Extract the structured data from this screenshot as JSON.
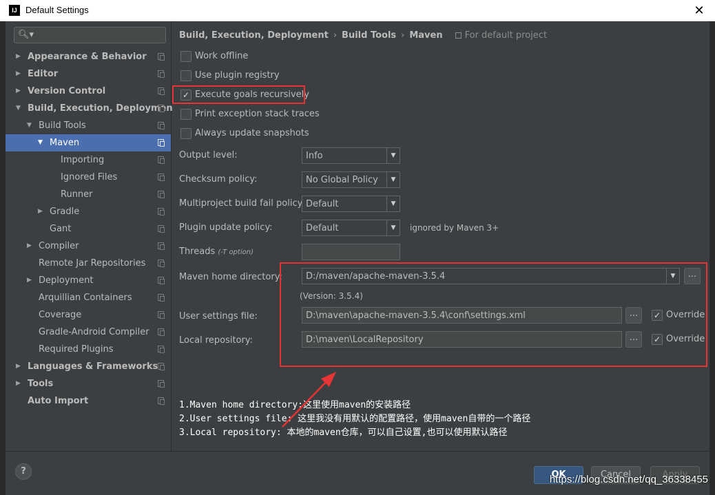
{
  "window": {
    "app_icon": "IJ",
    "title": "Default Settings",
    "close": "✕"
  },
  "search": {
    "placeholder": "",
    "icon": "search-icon"
  },
  "sidebar": {
    "items": [
      {
        "label": "Appearance & Behavior",
        "expanded": false
      },
      {
        "label": "Editor",
        "expanded": false
      },
      {
        "label": "Version Control",
        "expanded": false
      },
      {
        "label": "Build, Execution, Deployment",
        "expanded": true
      },
      {
        "label": "Build Tools",
        "expanded": true
      },
      {
        "label": "Maven",
        "expanded": true,
        "selected": true
      },
      {
        "label": "Importing"
      },
      {
        "label": "Ignored Files"
      },
      {
        "label": "Runner"
      },
      {
        "label": "Gradle",
        "expanded": false
      },
      {
        "label": "Gant"
      },
      {
        "label": "Compiler",
        "expanded": false
      },
      {
        "label": "Remote Jar Repositories"
      },
      {
        "label": "Deployment",
        "expanded": false
      },
      {
        "label": "Arquillian Containers"
      },
      {
        "label": "Coverage"
      },
      {
        "label": "Gradle-Android Compiler"
      },
      {
        "label": "Required Plugins"
      },
      {
        "label": "Languages & Frameworks",
        "expanded": false
      },
      {
        "label": "Tools",
        "expanded": false
      },
      {
        "label": "Auto Import"
      }
    ]
  },
  "breadcrumb": {
    "parts": [
      "Build, Execution, Deployment",
      "Build Tools",
      "Maven"
    ],
    "separator": "›",
    "scope": "For default project"
  },
  "checkboxes": [
    {
      "label": "Work offline",
      "checked": false
    },
    {
      "label": "Use plugin registry",
      "checked": false
    },
    {
      "label": "Execute goals recursively",
      "checked": true
    },
    {
      "label": "Print exception stack traces",
      "checked": false
    },
    {
      "label": "Always update snapshots",
      "checked": false
    }
  ],
  "form": {
    "output_level": {
      "label": "Output level:",
      "value": "Info"
    },
    "checksum_policy": {
      "label": "Checksum policy:",
      "value": "No Global Policy"
    },
    "multiproject_fail_policy": {
      "label": "Multiproject build fail policy:",
      "value": "Default"
    },
    "plugin_update_policy": {
      "label": "Plugin update policy:",
      "value": "Default",
      "note": "ignored by Maven 3+"
    },
    "threads": {
      "label": "Threads",
      "hint": "(-T option)",
      "value": ""
    },
    "maven_home": {
      "label": "Maven home directory:",
      "value": "D:/maven/apache-maven-3.5.4",
      "version": "(Version: 3.5.4)"
    },
    "user_settings": {
      "label": "User settings file:",
      "value": "D:\\maven\\apache-maven-3.5.4\\conf\\settings.xml",
      "override_label": "Override",
      "override": true
    },
    "local_repo": {
      "label": "Local repository:",
      "value": "D:\\maven\\LocalRepository",
      "override_label": "Override",
      "override": true
    },
    "browse_label": "...",
    "dropdown_arrow": "▼"
  },
  "notes": [
    "1.Maven home directory:这里使用maven的安装路径",
    "2.User settings file: 这里我没有用默认的配置路径，使用maven自带的一个路径",
    "3.Local repository: 本地的maven仓库，可以自己设置,也可以使用默认路径"
  ],
  "buttons": {
    "help": "?",
    "ok": "OK",
    "cancel": "Cancel",
    "apply": "Apply"
  },
  "watermark": "https://blog.csdn.net/qq_36338455",
  "colors": {
    "background": "#3c3f41",
    "selection": "#4b6eaf",
    "annotation": "#e63333",
    "ok_button": "#365880"
  }
}
